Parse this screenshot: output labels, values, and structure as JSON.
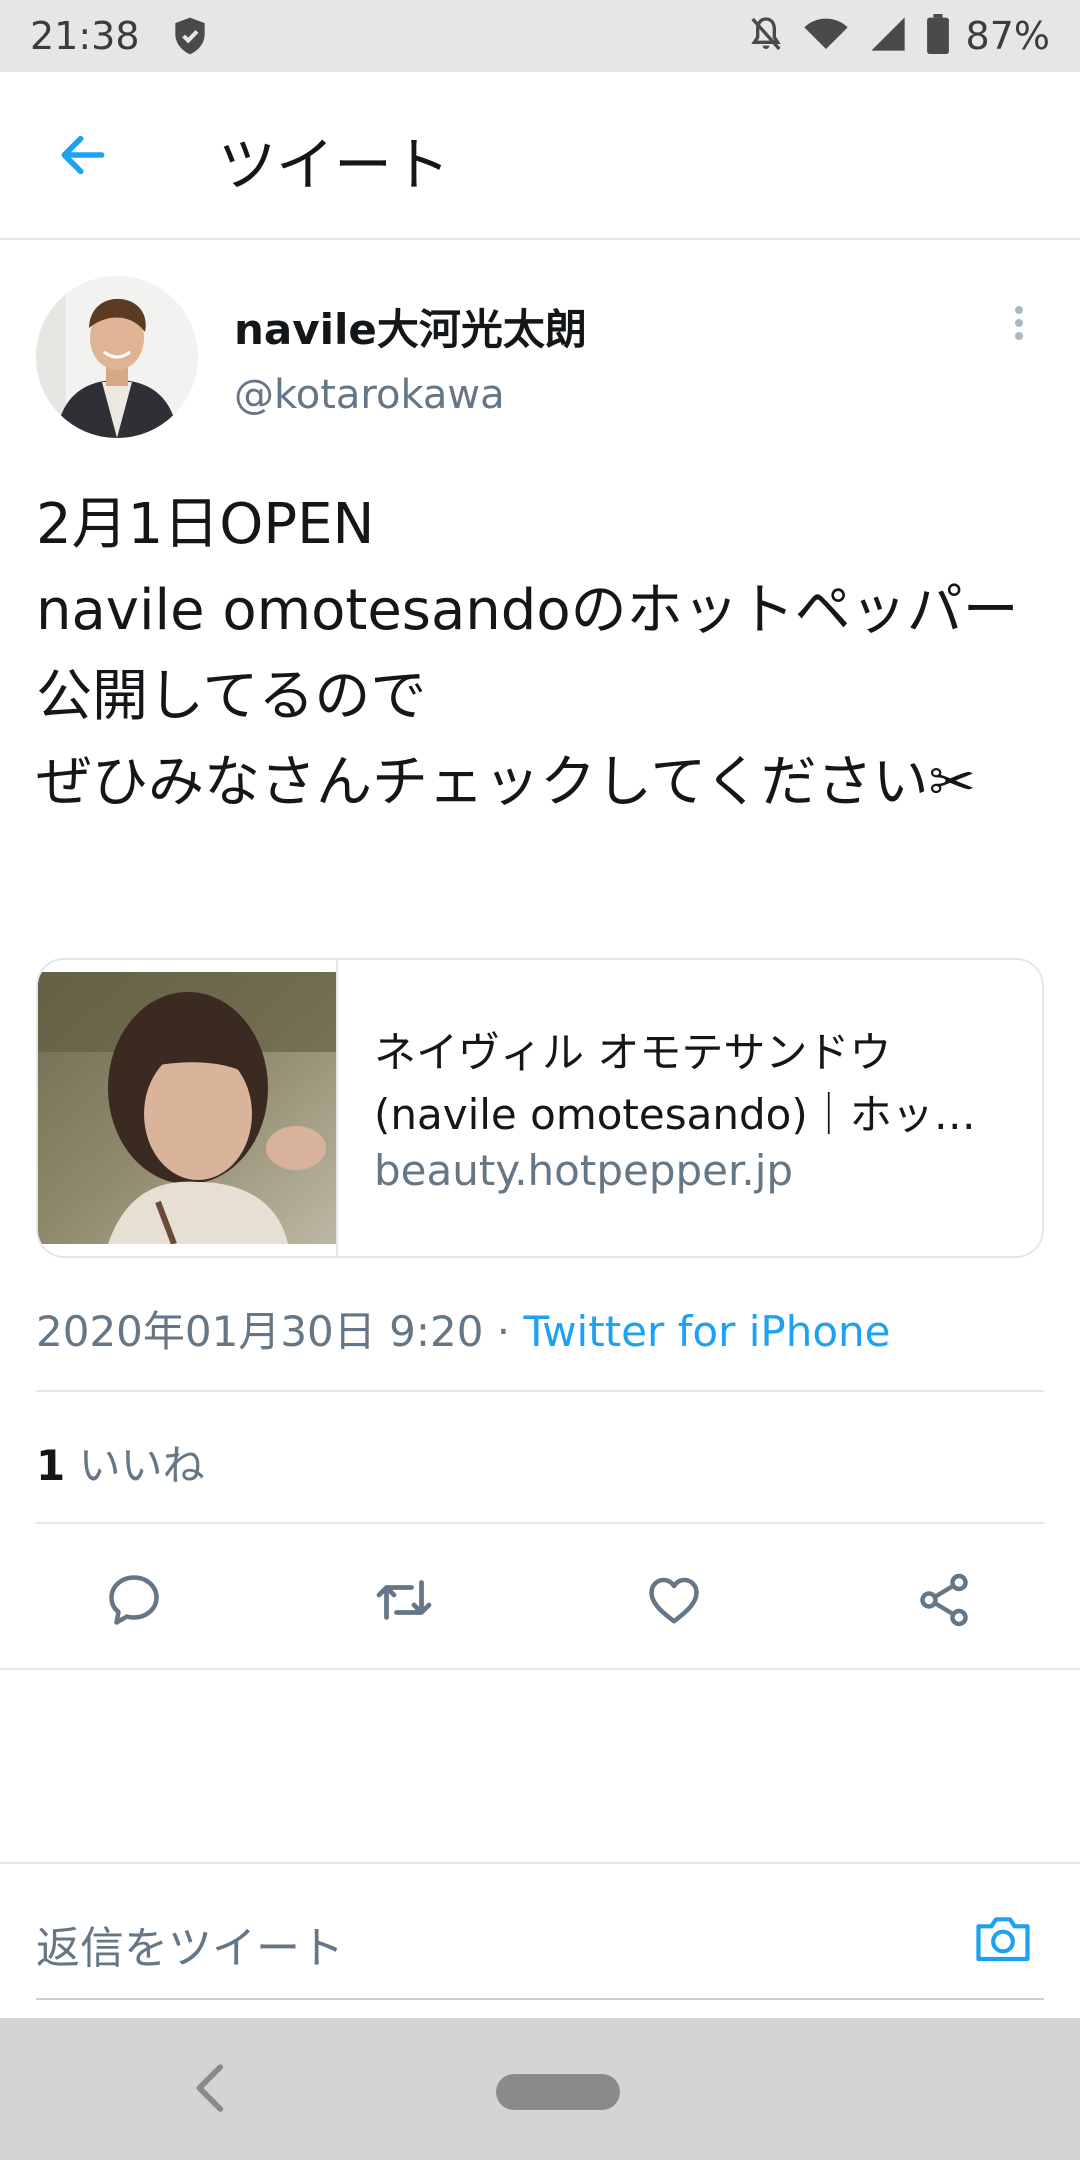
{
  "status_bar": {
    "time": "21:38",
    "battery": "87%",
    "icons": [
      "shield-icon",
      "mute-bell-icon",
      "wifi-icon",
      "signal-icon",
      "battery-icon"
    ]
  },
  "header": {
    "title": "ツイート",
    "back_icon": "arrow-left-icon"
  },
  "tweet": {
    "author_name": "navile大河光太朗",
    "author_handle": "@kotarokawa",
    "text": "2月1日OPEN\nnavile omotesandoのホットペッパー公開してるので\nぜひみなさんチェックしてください✂",
    "card": {
      "title_line1": "ネイヴィル オモテサンドウ",
      "title_line2": "(navile omotesando)｜ホット…",
      "domain": "beauty.hotpepper.jp"
    },
    "timestamp": "2020年01月30日 9:20 · ",
    "source": "Twitter for iPhone",
    "likes_count": "1",
    "likes_label": " いいね"
  },
  "actions": [
    "reply-icon",
    "retweet-icon",
    "like-icon",
    "share-icon"
  ],
  "reply": {
    "placeholder": "返信をツイート"
  },
  "colors": {
    "accent": "#1da1f2",
    "secondary_text": "#657786",
    "divider": "#e1e8ed"
  }
}
